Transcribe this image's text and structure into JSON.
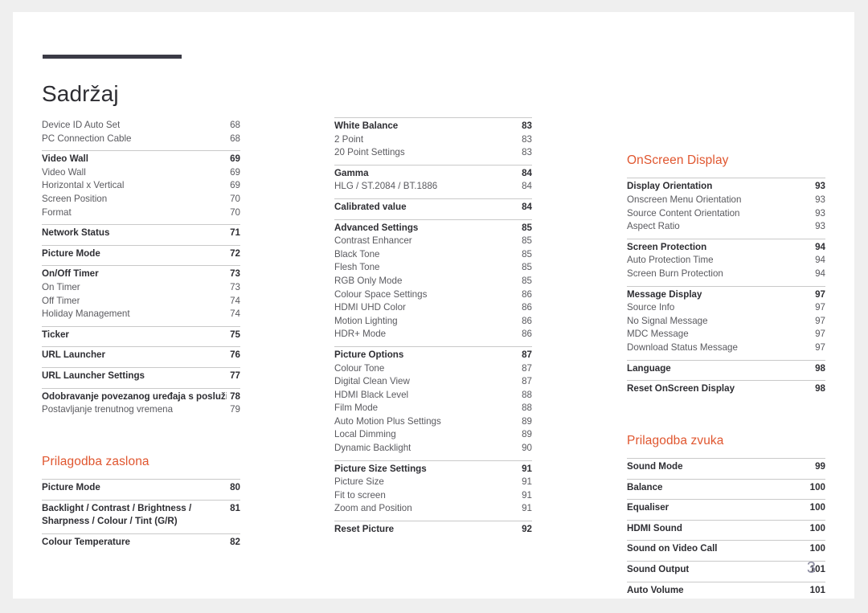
{
  "document": {
    "title": "Sadržaj",
    "page_number": "3",
    "accent_color": "#e0562f",
    "rule_color": "#3b3b46",
    "page_number_color": "#8e8ea3"
  },
  "columns": [
    {
      "name": "column-left",
      "groups": [
        {
          "rule": false,
          "rows": [
            {
              "label": "Device ID Auto Set",
              "page": "68",
              "bold": false
            },
            {
              "label": "PC Connection Cable",
              "page": "68",
              "bold": false
            }
          ]
        },
        {
          "rule": true,
          "rows": [
            {
              "label": "Video Wall",
              "page": "69",
              "bold": true
            },
            {
              "label": "Video Wall",
              "page": "69",
              "bold": false
            },
            {
              "label": "Horizontal x Vertical",
              "page": "69",
              "bold": false
            },
            {
              "label": "Screen Position",
              "page": "70",
              "bold": false
            },
            {
              "label": "Format",
              "page": "70",
              "bold": false
            }
          ]
        },
        {
          "rule": true,
          "rows": [
            {
              "label": "Network Status",
              "page": "71",
              "bold": true
            }
          ]
        },
        {
          "rule": true,
          "rows": [
            {
              "label": "Picture Mode",
              "page": "72",
              "bold": true
            }
          ]
        },
        {
          "rule": true,
          "rows": [
            {
              "label": "On/Off Timer",
              "page": "73",
              "bold": true
            },
            {
              "label": "On Timer",
              "page": "73",
              "bold": false
            },
            {
              "label": "Off Timer",
              "page": "74",
              "bold": false
            },
            {
              "label": "Holiday Management",
              "page": "74",
              "bold": false
            }
          ]
        },
        {
          "rule": true,
          "rows": [
            {
              "label": "Ticker",
              "page": "75",
              "bold": true
            }
          ]
        },
        {
          "rule": true,
          "rows": [
            {
              "label": "URL Launcher",
              "page": "76",
              "bold": true
            }
          ]
        },
        {
          "rule": true,
          "rows": [
            {
              "label": "URL Launcher Settings",
              "page": "77",
              "bold": true
            }
          ]
        },
        {
          "rule": true,
          "rows": [
            {
              "label": "Odobravanje povezanog uređaja s poslužitelja",
              "page": "78",
              "bold": true,
              "inline_page": true
            },
            {
              "label": "Postavljanje trenutnog vremena",
              "page": "79",
              "bold": false
            }
          ]
        }
      ],
      "section": {
        "heading": "Prilagodba zaslona",
        "groups": [
          {
            "rule": true,
            "rows": [
              {
                "label": "Picture Mode",
                "page": "80",
                "bold": true
              }
            ]
          },
          {
            "rule": true,
            "rows": [
              {
                "label": "Backlight / Contrast / Brightness / Sharpness / Colour / Tint (G/R)",
                "page": "81",
                "bold": true,
                "wrap": true
              }
            ]
          },
          {
            "rule": true,
            "rows": [
              {
                "label": "Colour Temperature",
                "page": "82",
                "bold": true
              }
            ]
          }
        ]
      }
    },
    {
      "name": "column-middle",
      "groups": [
        {
          "rule": true,
          "rows": [
            {
              "label": "White Balance",
              "page": "83",
              "bold": true
            },
            {
              "label": "2 Point",
              "page": "83",
              "bold": false
            },
            {
              "label": "20 Point Settings",
              "page": "83",
              "bold": false
            }
          ]
        },
        {
          "rule": true,
          "rows": [
            {
              "label": "Gamma",
              "page": "84",
              "bold": true
            },
            {
              "label": "HLG / ST.2084 / BT.1886",
              "page": "84",
              "bold": false
            }
          ]
        },
        {
          "rule": true,
          "rows": [
            {
              "label": "Calibrated value",
              "page": "84",
              "bold": true
            }
          ]
        },
        {
          "rule": true,
          "rows": [
            {
              "label": "Advanced Settings",
              "page": "85",
              "bold": true
            },
            {
              "label": "Contrast Enhancer",
              "page": "85",
              "bold": false
            },
            {
              "label": "Black Tone",
              "page": "85",
              "bold": false
            },
            {
              "label": "Flesh Tone",
              "page": "85",
              "bold": false
            },
            {
              "label": "RGB Only Mode",
              "page": "85",
              "bold": false
            },
            {
              "label": "Colour Space Settings",
              "page": "86",
              "bold": false
            },
            {
              "label": "HDMI UHD Color",
              "page": "86",
              "bold": false
            },
            {
              "label": "Motion Lighting",
              "page": "86",
              "bold": false
            },
            {
              "label": "HDR+ Mode",
              "page": "86",
              "bold": false
            }
          ]
        },
        {
          "rule": true,
          "rows": [
            {
              "label": "Picture Options",
              "page": "87",
              "bold": true
            },
            {
              "label": "Colour Tone",
              "page": "87",
              "bold": false
            },
            {
              "label": "Digital Clean View",
              "page": "87",
              "bold": false
            },
            {
              "label": "HDMI Black Level",
              "page": "88",
              "bold": false
            },
            {
              "label": "Film Mode",
              "page": "88",
              "bold": false
            },
            {
              "label": "Auto Motion Plus Settings",
              "page": "89",
              "bold": false
            },
            {
              "label": "Local Dimming",
              "page": "89",
              "bold": false
            },
            {
              "label": "Dynamic Backlight",
              "page": "90",
              "bold": false
            }
          ]
        },
        {
          "rule": true,
          "rows": [
            {
              "label": "Picture Size Settings",
              "page": "91",
              "bold": true
            },
            {
              "label": "Picture Size",
              "page": "91",
              "bold": false
            },
            {
              "label": "Fit to screen",
              "page": "91",
              "bold": false
            },
            {
              "label": "Zoom and Position",
              "page": "91",
              "bold": false
            }
          ]
        },
        {
          "rule": true,
          "rows": [
            {
              "label": "Reset Picture",
              "page": "92",
              "bold": true
            }
          ]
        }
      ],
      "section": null
    },
    {
      "name": "column-right",
      "groups": [],
      "section": {
        "heading": "OnScreen Display",
        "groups": [
          {
            "rule": true,
            "rows": [
              {
                "label": "Display Orientation",
                "page": "93",
                "bold": true
              },
              {
                "label": "Onscreen Menu Orientation",
                "page": "93",
                "bold": false
              },
              {
                "label": "Source Content Orientation",
                "page": "93",
                "bold": false
              },
              {
                "label": "Aspect Ratio",
                "page": "93",
                "bold": false
              }
            ]
          },
          {
            "rule": true,
            "rows": [
              {
                "label": "Screen Protection",
                "page": "94",
                "bold": true
              },
              {
                "label": "Auto Protection Time",
                "page": "94",
                "bold": false
              },
              {
                "label": "Screen Burn Protection",
                "page": "94",
                "bold": false
              }
            ]
          },
          {
            "rule": true,
            "rows": [
              {
                "label": "Message Display",
                "page": "97",
                "bold": true
              },
              {
                "label": "Source Info",
                "page": "97",
                "bold": false
              },
              {
                "label": "No Signal Message",
                "page": "97",
                "bold": false
              },
              {
                "label": "MDC Message",
                "page": "97",
                "bold": false
              },
              {
                "label": "Download Status Message",
                "page": "97",
                "bold": false
              }
            ]
          },
          {
            "rule": true,
            "rows": [
              {
                "label": "Language",
                "page": "98",
                "bold": true
              }
            ]
          },
          {
            "rule": true,
            "rows": [
              {
                "label": "Reset OnScreen Display",
                "page": "98",
                "bold": true
              }
            ]
          }
        ]
      },
      "section2": {
        "heading": "Prilagodba zvuka",
        "groups": [
          {
            "rule": true,
            "rows": [
              {
                "label": "Sound Mode",
                "page": "99",
                "bold": true
              }
            ]
          },
          {
            "rule": true,
            "rows": [
              {
                "label": "Balance",
                "page": "100",
                "bold": true
              }
            ]
          },
          {
            "rule": true,
            "rows": [
              {
                "label": "Equaliser",
                "page": "100",
                "bold": true
              }
            ]
          },
          {
            "rule": true,
            "rows": [
              {
                "label": "HDMI Sound",
                "page": "100",
                "bold": true
              }
            ]
          },
          {
            "rule": true,
            "rows": [
              {
                "label": "Sound on Video Call",
                "page": "100",
                "bold": true
              }
            ]
          },
          {
            "rule": true,
            "rows": [
              {
                "label": "Sound Output",
                "page": "101",
                "bold": true
              }
            ]
          },
          {
            "rule": true,
            "rows": [
              {
                "label": "Auto Volume",
                "page": "101",
                "bold": true
              }
            ]
          }
        ]
      }
    }
  ]
}
